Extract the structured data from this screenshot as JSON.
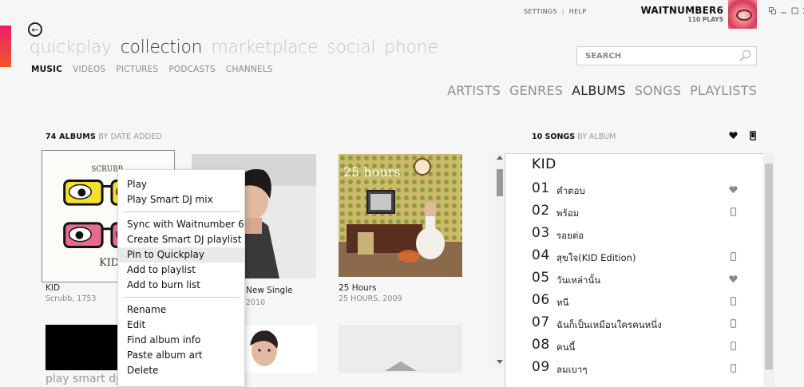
{
  "nav": {
    "back_label": "←",
    "pivots": [
      {
        "label": "quickplay",
        "active": false
      },
      {
        "label": "collection",
        "active": true
      },
      {
        "label": "marketplace",
        "active": false
      },
      {
        "label": "social",
        "active": false
      },
      {
        "label": "phone",
        "active": false
      }
    ],
    "subnav": [
      {
        "label": "MUSIC",
        "active": true
      },
      {
        "label": "VIDEOS",
        "active": false
      },
      {
        "label": "PICTURES",
        "active": false
      },
      {
        "label": "PODCASTS",
        "active": false
      },
      {
        "label": "CHANNELS",
        "active": false
      }
    ]
  },
  "top_links": {
    "settings": "SETTINGS",
    "separator": "|",
    "help": "HELP"
  },
  "user": {
    "name": "WAITNUMBER6",
    "plays": "110 PLAYS"
  },
  "search": {
    "placeholder": "SEARCH"
  },
  "categories": [
    {
      "label": "ARTISTS",
      "active": false
    },
    {
      "label": "GENRES",
      "active": false
    },
    {
      "label": "ALBUMS",
      "active": true
    },
    {
      "label": "SONGS",
      "active": false
    },
    {
      "label": "PLAYLISTS",
      "active": false
    }
  ],
  "albums_header": {
    "count": "74 ALBUMS",
    "sort": "BY DATE ADDED"
  },
  "albums": [
    {
      "title": "KID",
      "subtitle": "Scrubb, 1753",
      "cover_text_top": "SCRUBB",
      "cover_text_bottom": "KID"
    },
    {
      "title": "New Single",
      "subtitle": "2010"
    },
    {
      "title": "25 Hours",
      "subtitle": "25 HOURS, 2009",
      "cover_text": "25 hours"
    }
  ],
  "tiles": {
    "play_smart_dj": "play smart dj"
  },
  "context_menu": {
    "group1": [
      "Play",
      "Play Smart DJ mix"
    ],
    "group2": [
      "Sync with Waitnumber 6",
      "Create Smart DJ playlist",
      "Pin to Quickplay",
      "Add to playlist",
      "Add to burn list"
    ],
    "group3": [
      "Rename",
      "Edit",
      "Find album info",
      "Paste album art",
      "Delete"
    ],
    "hovered": "Pin to Quickplay"
  },
  "songs_panel": {
    "header_count": "10 SONGS",
    "header_sort": "BY ALBUM",
    "album_title": "KID",
    "songs": [
      {
        "num": "01",
        "name": "คำตอบ",
        "icon": "heart-icon"
      },
      {
        "num": "02",
        "name": "พร้อม",
        "icon": "phone-icon"
      },
      {
        "num": "03",
        "name": "รอยต่อ",
        "icon": ""
      },
      {
        "num": "04",
        "name": "สุขใจ(KID Edition)",
        "icon": "phone-icon"
      },
      {
        "num": "05",
        "name": "วันเหล่านั้น",
        "icon": "heart-icon"
      },
      {
        "num": "06",
        "name": "หนี",
        "icon": "phone-icon"
      },
      {
        "num": "07",
        "name": "ฉันก็เป็นเหมือนใครคนหนึ่ง",
        "icon": "phone-icon"
      },
      {
        "num": "08",
        "name": "คนนี้",
        "icon": "phone-icon"
      },
      {
        "num": "09",
        "name": "ลมเบาๆ",
        "icon": "phone-icon"
      }
    ]
  },
  "colors": {
    "accent_top": "#ec1c6b",
    "accent_bottom": "#f05a28"
  }
}
